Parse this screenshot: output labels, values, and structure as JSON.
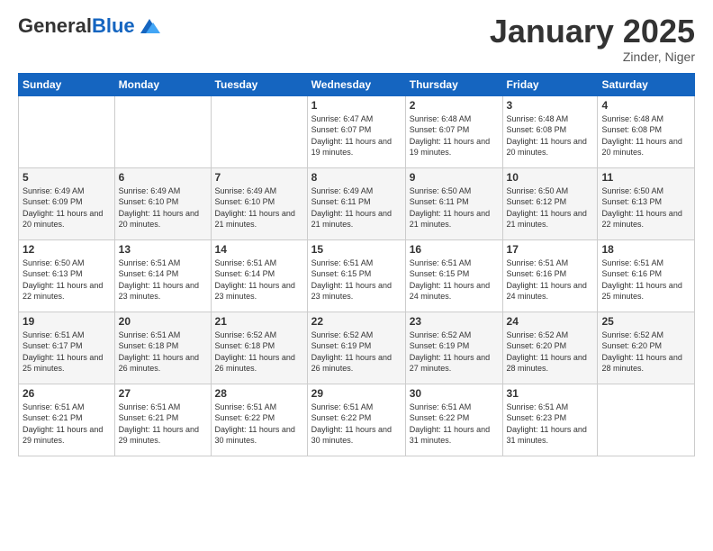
{
  "logo": {
    "general": "General",
    "blue": "Blue"
  },
  "header": {
    "month": "January 2025",
    "location": "Zinder, Niger"
  },
  "days_of_week": [
    "Sunday",
    "Monday",
    "Tuesday",
    "Wednesday",
    "Thursday",
    "Friday",
    "Saturday"
  ],
  "weeks": [
    [
      {
        "day": "",
        "sunrise": "",
        "sunset": "",
        "daylight": ""
      },
      {
        "day": "",
        "sunrise": "",
        "sunset": "",
        "daylight": ""
      },
      {
        "day": "",
        "sunrise": "",
        "sunset": "",
        "daylight": ""
      },
      {
        "day": "1",
        "sunrise": "Sunrise: 6:47 AM",
        "sunset": "Sunset: 6:07 PM",
        "daylight": "Daylight: 11 hours and 19 minutes."
      },
      {
        "day": "2",
        "sunrise": "Sunrise: 6:48 AM",
        "sunset": "Sunset: 6:07 PM",
        "daylight": "Daylight: 11 hours and 19 minutes."
      },
      {
        "day": "3",
        "sunrise": "Sunrise: 6:48 AM",
        "sunset": "Sunset: 6:08 PM",
        "daylight": "Daylight: 11 hours and 20 minutes."
      },
      {
        "day": "4",
        "sunrise": "Sunrise: 6:48 AM",
        "sunset": "Sunset: 6:08 PM",
        "daylight": "Daylight: 11 hours and 20 minutes."
      }
    ],
    [
      {
        "day": "5",
        "sunrise": "Sunrise: 6:49 AM",
        "sunset": "Sunset: 6:09 PM",
        "daylight": "Daylight: 11 hours and 20 minutes."
      },
      {
        "day": "6",
        "sunrise": "Sunrise: 6:49 AM",
        "sunset": "Sunset: 6:10 PM",
        "daylight": "Daylight: 11 hours and 20 minutes."
      },
      {
        "day": "7",
        "sunrise": "Sunrise: 6:49 AM",
        "sunset": "Sunset: 6:10 PM",
        "daylight": "Daylight: 11 hours and 21 minutes."
      },
      {
        "day": "8",
        "sunrise": "Sunrise: 6:49 AM",
        "sunset": "Sunset: 6:11 PM",
        "daylight": "Daylight: 11 hours and 21 minutes."
      },
      {
        "day": "9",
        "sunrise": "Sunrise: 6:50 AM",
        "sunset": "Sunset: 6:11 PM",
        "daylight": "Daylight: 11 hours and 21 minutes."
      },
      {
        "day": "10",
        "sunrise": "Sunrise: 6:50 AM",
        "sunset": "Sunset: 6:12 PM",
        "daylight": "Daylight: 11 hours and 21 minutes."
      },
      {
        "day": "11",
        "sunrise": "Sunrise: 6:50 AM",
        "sunset": "Sunset: 6:13 PM",
        "daylight": "Daylight: 11 hours and 22 minutes."
      }
    ],
    [
      {
        "day": "12",
        "sunrise": "Sunrise: 6:50 AM",
        "sunset": "Sunset: 6:13 PM",
        "daylight": "Daylight: 11 hours and 22 minutes."
      },
      {
        "day": "13",
        "sunrise": "Sunrise: 6:51 AM",
        "sunset": "Sunset: 6:14 PM",
        "daylight": "Daylight: 11 hours and 23 minutes."
      },
      {
        "day": "14",
        "sunrise": "Sunrise: 6:51 AM",
        "sunset": "Sunset: 6:14 PM",
        "daylight": "Daylight: 11 hours and 23 minutes."
      },
      {
        "day": "15",
        "sunrise": "Sunrise: 6:51 AM",
        "sunset": "Sunset: 6:15 PM",
        "daylight": "Daylight: 11 hours and 23 minutes."
      },
      {
        "day": "16",
        "sunrise": "Sunrise: 6:51 AM",
        "sunset": "Sunset: 6:15 PM",
        "daylight": "Daylight: 11 hours and 24 minutes."
      },
      {
        "day": "17",
        "sunrise": "Sunrise: 6:51 AM",
        "sunset": "Sunset: 6:16 PM",
        "daylight": "Daylight: 11 hours and 24 minutes."
      },
      {
        "day": "18",
        "sunrise": "Sunrise: 6:51 AM",
        "sunset": "Sunset: 6:16 PM",
        "daylight": "Daylight: 11 hours and 25 minutes."
      }
    ],
    [
      {
        "day": "19",
        "sunrise": "Sunrise: 6:51 AM",
        "sunset": "Sunset: 6:17 PM",
        "daylight": "Daylight: 11 hours and 25 minutes."
      },
      {
        "day": "20",
        "sunrise": "Sunrise: 6:51 AM",
        "sunset": "Sunset: 6:18 PM",
        "daylight": "Daylight: 11 hours and 26 minutes."
      },
      {
        "day": "21",
        "sunrise": "Sunrise: 6:52 AM",
        "sunset": "Sunset: 6:18 PM",
        "daylight": "Daylight: 11 hours and 26 minutes."
      },
      {
        "day": "22",
        "sunrise": "Sunrise: 6:52 AM",
        "sunset": "Sunset: 6:19 PM",
        "daylight": "Daylight: 11 hours and 26 minutes."
      },
      {
        "day": "23",
        "sunrise": "Sunrise: 6:52 AM",
        "sunset": "Sunset: 6:19 PM",
        "daylight": "Daylight: 11 hours and 27 minutes."
      },
      {
        "day": "24",
        "sunrise": "Sunrise: 6:52 AM",
        "sunset": "Sunset: 6:20 PM",
        "daylight": "Daylight: 11 hours and 28 minutes."
      },
      {
        "day": "25",
        "sunrise": "Sunrise: 6:52 AM",
        "sunset": "Sunset: 6:20 PM",
        "daylight": "Daylight: 11 hours and 28 minutes."
      }
    ],
    [
      {
        "day": "26",
        "sunrise": "Sunrise: 6:51 AM",
        "sunset": "Sunset: 6:21 PM",
        "daylight": "Daylight: 11 hours and 29 minutes."
      },
      {
        "day": "27",
        "sunrise": "Sunrise: 6:51 AM",
        "sunset": "Sunset: 6:21 PM",
        "daylight": "Daylight: 11 hours and 29 minutes."
      },
      {
        "day": "28",
        "sunrise": "Sunrise: 6:51 AM",
        "sunset": "Sunset: 6:22 PM",
        "daylight": "Daylight: 11 hours and 30 minutes."
      },
      {
        "day": "29",
        "sunrise": "Sunrise: 6:51 AM",
        "sunset": "Sunset: 6:22 PM",
        "daylight": "Daylight: 11 hours and 30 minutes."
      },
      {
        "day": "30",
        "sunrise": "Sunrise: 6:51 AM",
        "sunset": "Sunset: 6:22 PM",
        "daylight": "Daylight: 11 hours and 31 minutes."
      },
      {
        "day": "31",
        "sunrise": "Sunrise: 6:51 AM",
        "sunset": "Sunset: 6:23 PM",
        "daylight": "Daylight: 11 hours and 31 minutes."
      },
      {
        "day": "",
        "sunrise": "",
        "sunset": "",
        "daylight": ""
      }
    ]
  ]
}
